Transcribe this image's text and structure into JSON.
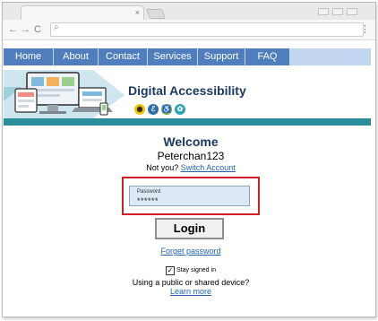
{
  "browser": {
    "tab_close": "×",
    "kebab": "⋮",
    "nav_back": "←",
    "nav_forward": "→",
    "nav_reload": "C",
    "search_glyph": "⌕"
  },
  "menu": {
    "items": [
      {
        "label": "Home"
      },
      {
        "label": "About"
      },
      {
        "label": "Contact"
      },
      {
        "label": "Services"
      },
      {
        "label": "Support"
      },
      {
        "label": "FAQ"
      }
    ],
    "bar_color": "#4f7dbd"
  },
  "banner": {
    "title": "Digital Accessibility",
    "accent_color": "#2a8d9c",
    "icons": [
      "eye-icon",
      "ear-icon",
      "wheelchair-icon",
      "brain-icon"
    ]
  },
  "login": {
    "heading": "Welcome",
    "username": "Peterchan123",
    "not_you_text": "Not you?",
    "switch_account_link": "Switch Account",
    "password_label": "Password",
    "password_value": "******",
    "login_button": "Login",
    "forget_password_link": "Forget password",
    "stay_signed_in_label": "Stay signed in",
    "stay_signed_in_checked": true,
    "public_device_text": "Using a public or shared device?",
    "learn_more_link": "Learn more"
  }
}
